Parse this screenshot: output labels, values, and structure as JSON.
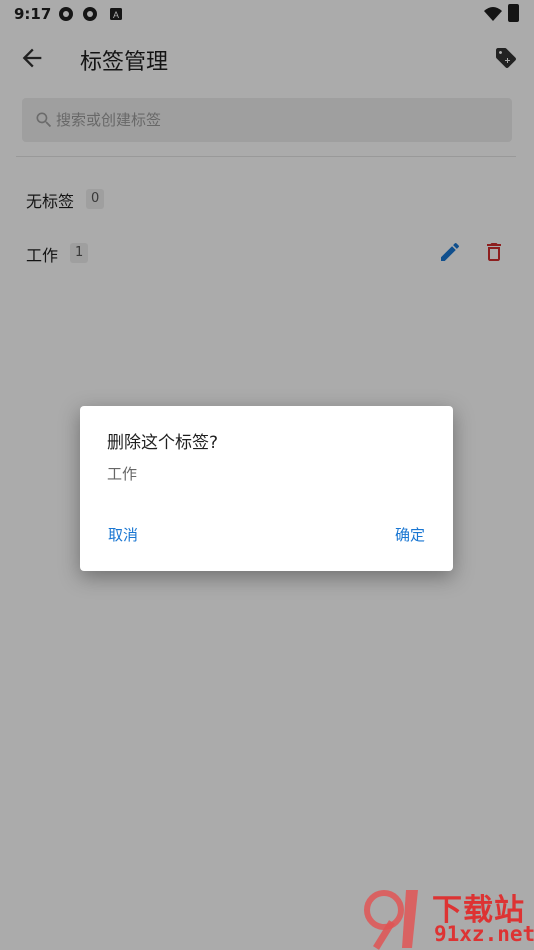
{
  "status_bar": {
    "time": "9:17"
  },
  "toolbar": {
    "title": "标签管理"
  },
  "search": {
    "placeholder": "搜索或创建标签"
  },
  "tags": [
    {
      "label": "无标签",
      "count": "0",
      "editable": false
    },
    {
      "label": "工作",
      "count": "1",
      "editable": true
    }
  ],
  "dialog": {
    "title": "删除这个标签?",
    "message": "工作",
    "cancel_label": "取消",
    "confirm_label": "确定"
  },
  "watermark": {
    "text": "下载站",
    "url": "91xz.net",
    "logo": "9f"
  },
  "colors": {
    "accent": "#1976d2",
    "danger": "#d32f2f",
    "watermark": "#dd3333"
  }
}
